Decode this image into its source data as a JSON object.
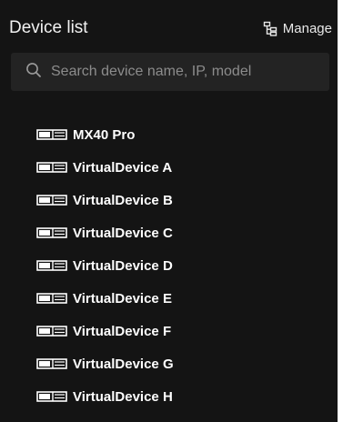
{
  "panel": {
    "title": "Device list",
    "manage_label": "Manage",
    "manage_icon": "tree-structure-icon"
  },
  "search": {
    "placeholder": "Search device name, IP, model",
    "value": "",
    "icon": "search-icon"
  },
  "devices": [
    {
      "name": "MX40 Pro",
      "icon": "device-icon"
    },
    {
      "name": "VirtualDevice A",
      "icon": "device-icon"
    },
    {
      "name": "VirtualDevice B",
      "icon": "device-icon"
    },
    {
      "name": "VirtualDevice C",
      "icon": "device-icon"
    },
    {
      "name": "VirtualDevice D",
      "icon": "device-icon"
    },
    {
      "name": "VirtualDevice E",
      "icon": "device-icon"
    },
    {
      "name": "VirtualDevice F",
      "icon": "device-icon"
    },
    {
      "name": "VirtualDevice G",
      "icon": "device-icon"
    },
    {
      "name": "VirtualDevice H",
      "icon": "device-icon"
    }
  ],
  "colors": {
    "panel_bg": "#141414",
    "search_bg": "#232323",
    "text": "#ffffff",
    "placeholder": "#8c8c8c"
  }
}
